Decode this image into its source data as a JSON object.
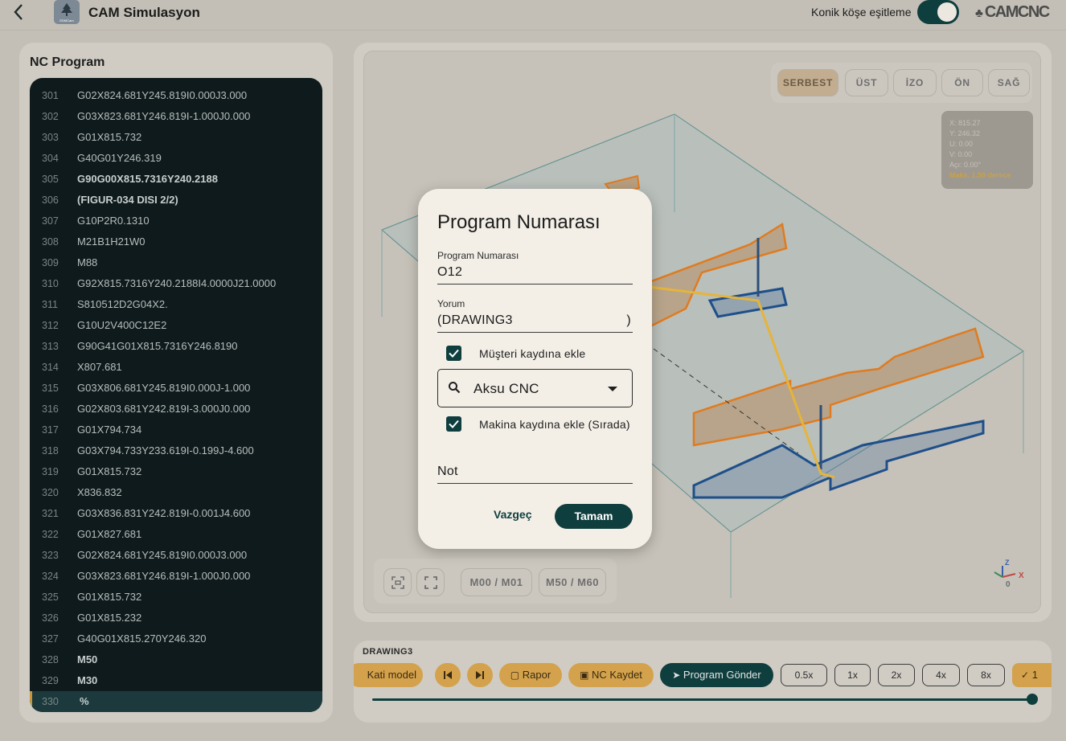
{
  "header": {
    "title": "CAM Simulasyon",
    "app_icon_caption": "EDMCam",
    "toggle_label": "Konik köşe eşitleme",
    "toggle_on": true,
    "brand": "CAMCNC"
  },
  "nc_program": {
    "title": "NC Program",
    "lines": [
      {
        "n": "301",
        "code": "G02X824.681Y245.819I0.000J3.000",
        "bold": false
      },
      {
        "n": "302",
        "code": "G03X823.681Y246.819I-1.000J0.000",
        "bold": false
      },
      {
        "n": "303",
        "code": "G01X815.732",
        "bold": false
      },
      {
        "n": "304",
        "code": "G40G01Y246.319",
        "bold": false
      },
      {
        "n": "305",
        "code": "G90G00X815.7316Y240.2188",
        "bold": true
      },
      {
        "n": "306",
        "code": "(FIGUR-034 DISI 2/2)",
        "bold": true
      },
      {
        "n": "307",
        "code": "G10P2R0.1310",
        "bold": false
      },
      {
        "n": "308",
        "code": "M21B1H21W0",
        "bold": false
      },
      {
        "n": "309",
        "code": "M88",
        "bold": false
      },
      {
        "n": "310",
        "code": "G92X815.7316Y240.2188I4.0000J21.0000",
        "bold": false
      },
      {
        "n": "311",
        "code": "S810512D2G04X2.",
        "bold": false
      },
      {
        "n": "312",
        "code": "G10U2V400C12E2",
        "bold": false
      },
      {
        "n": "313",
        "code": "G90G41G01X815.7316Y246.8190",
        "bold": false
      },
      {
        "n": "314",
        "code": "X807.681",
        "bold": false
      },
      {
        "n": "315",
        "code": "G03X806.681Y245.819I0.000J-1.000",
        "bold": false
      },
      {
        "n": "316",
        "code": "G02X803.681Y242.819I-3.000J0.000",
        "bold": false
      },
      {
        "n": "317",
        "code": "G01X794.734",
        "bold": false
      },
      {
        "n": "318",
        "code": "G03X794.733Y233.619I-0.199J-4.600",
        "bold": false
      },
      {
        "n": "319",
        "code": "G01X815.732",
        "bold": false
      },
      {
        "n": "320",
        "code": "X836.832",
        "bold": false
      },
      {
        "n": "321",
        "code": "G03X836.831Y242.819I-0.001J4.600",
        "bold": false
      },
      {
        "n": "322",
        "code": "G01X827.681",
        "bold": false
      },
      {
        "n": "323",
        "code": "G02X824.681Y245.819I0.000J3.000",
        "bold": false
      },
      {
        "n": "324",
        "code": "G03X823.681Y246.819I-1.000J0.000",
        "bold": false
      },
      {
        "n": "325",
        "code": "G01X815.732",
        "bold": false
      },
      {
        "n": "326",
        "code": "G01X815.232",
        "bold": false
      },
      {
        "n": "327",
        "code": "G40G01X815.270Y246.320",
        "bold": false
      },
      {
        "n": "328",
        "code": "M50",
        "bold": true
      },
      {
        "n": "329",
        "code": "M30",
        "bold": true
      },
      {
        "n": "330",
        "code": "%",
        "bold": true,
        "active": true
      }
    ]
  },
  "viewer": {
    "tabs": [
      "SERBEST",
      "ÜST",
      "İZO",
      "ÖN",
      "SAĞ"
    ],
    "active_tab": "SERBEST",
    "coords": {
      "x": "X: 815.27",
      "y": "Y: 246.32",
      "u": "U: 0.00",
      "v": "V: 0.00",
      "angle": "Açı: 0.00°",
      "max": "Maks. 1.50 derece"
    },
    "tools": {
      "m00": "M00 / M01",
      "m50": "M50 / M60"
    },
    "axis": {
      "x": "X",
      "z": "Z",
      "origin": "0"
    },
    "colors": {
      "accent": "#0f3e3e",
      "path": "#e07b1f",
      "path_lower": "#1e4f8a",
      "rapid": "#e6b43a"
    }
  },
  "playbar": {
    "program_name": "DRAWING3",
    "buttons": {
      "solid": "Kati model",
      "report": "Rapor",
      "save_nc": "NC Kaydet",
      "send": "Program Gönder",
      "last_partial": "1"
    },
    "speeds": [
      "0.5x",
      "1x",
      "2x",
      "4x",
      "8x"
    ],
    "progress": 1.0
  },
  "dialog": {
    "title": "Program Numarası",
    "program_label": "Program Numarası",
    "program_value": "O12",
    "comment_label": "Yorum",
    "comment_value": "(DRAWING3",
    "comment_close": ")",
    "customer_check_label": "Müşteri kaydına ekle",
    "customer_check": true,
    "customer_select": "Aksu CNC",
    "machine_check_label": "Makina kaydına ekle (Sırada)",
    "machine_check": true,
    "note_placeholder": "Not",
    "cancel": "Vazgeç",
    "ok": "Tamam"
  }
}
